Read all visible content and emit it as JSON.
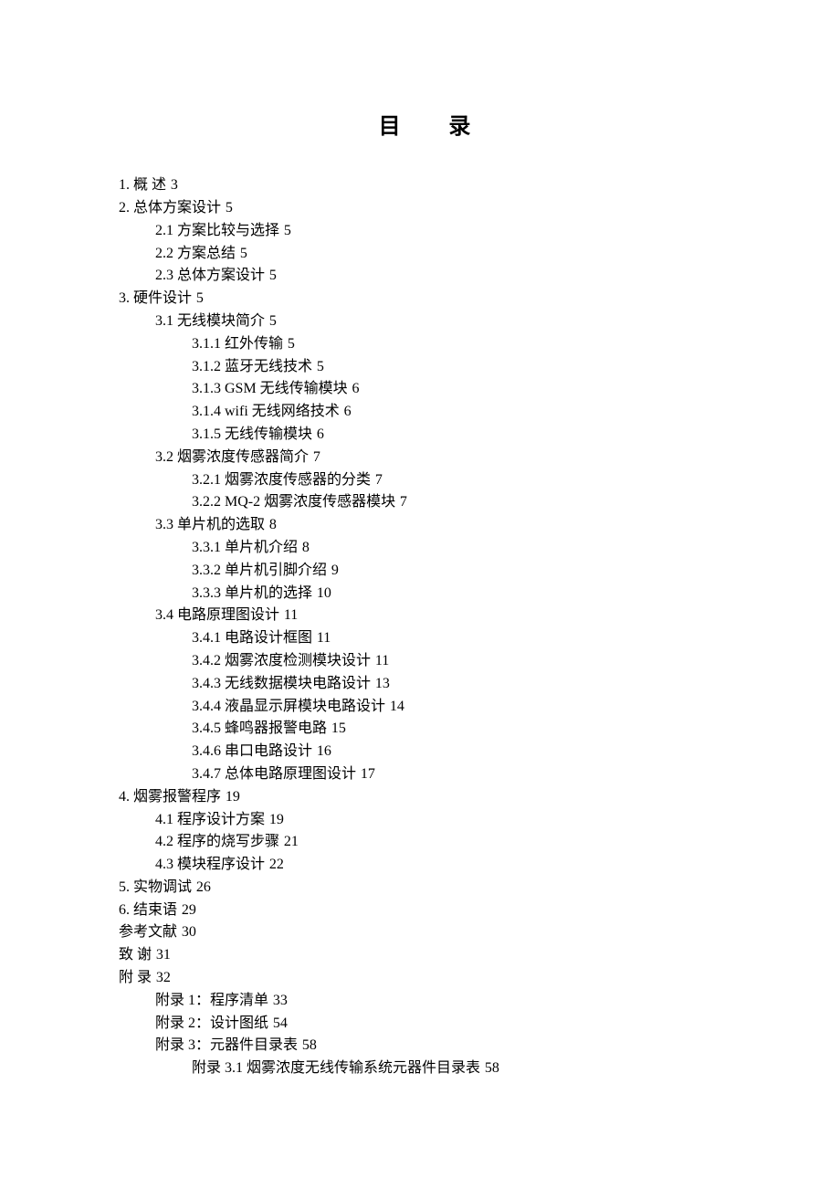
{
  "title_part1": "目",
  "title_part2": "录",
  "toc": [
    {
      "level": 0,
      "text": "1. 概    述",
      "page": "3"
    },
    {
      "level": 0,
      "text": "2. 总体方案设计",
      "page": "5"
    },
    {
      "level": 1,
      "text": "2.1 方案比较与选择",
      "page": "5"
    },
    {
      "level": 1,
      "text": "2.2 方案总结",
      "page": "5"
    },
    {
      "level": 1,
      "text": "2.3 总体方案设计",
      "page": "5"
    },
    {
      "level": 0,
      "text": "3. 硬件设计",
      "page": "5"
    },
    {
      "level": 1,
      "text": "3.1 无线模块简介",
      "page": "5"
    },
    {
      "level": 2,
      "text": "3.1.1 红外传输",
      "page": "5"
    },
    {
      "level": 2,
      "text": "3.1.2 蓝牙无线技术",
      "page": "5"
    },
    {
      "level": 2,
      "text": "3.1.3 GSM 无线传输模块",
      "page": "6"
    },
    {
      "level": 2,
      "text": "3.1.4 wifi 无线网络技术",
      "page": "6"
    },
    {
      "level": 2,
      "text": "3.1.5 无线传输模块",
      "page": "6"
    },
    {
      "level": 1,
      "text": "3.2 烟雾浓度传感器简介",
      "page": "7"
    },
    {
      "level": 2,
      "text": "3.2.1 烟雾浓度传感器的分类",
      "page": "7"
    },
    {
      "level": 2,
      "text": "3.2.2 MQ-2 烟雾浓度传感器模块",
      "page": "7"
    },
    {
      "level": 1,
      "text": "3.3 单片机的选取",
      "page": "8"
    },
    {
      "level": 2,
      "text": "3.3.1 单片机介绍",
      "page": "8"
    },
    {
      "level": 2,
      "text": "3.3.2 单片机引脚介绍",
      "page": "9"
    },
    {
      "level": 2,
      "text": "3.3.3 单片机的选择",
      "page": "10"
    },
    {
      "level": 1,
      "text": "3.4 电路原理图设计",
      "page": "11"
    },
    {
      "level": 2,
      "text": "3.4.1 电路设计框图",
      "page": "11"
    },
    {
      "level": 2,
      "text": "3.4.2 烟雾浓度检测模块设计",
      "page": "11"
    },
    {
      "level": 2,
      "text": "3.4.3 无线数据模块电路设计",
      "page": "13"
    },
    {
      "level": 2,
      "text": "3.4.4 液晶显示屏模块电路设计",
      "page": "14"
    },
    {
      "level": 2,
      "text": "3.4.5 蜂鸣器报警电路",
      "page": "15"
    },
    {
      "level": 2,
      "text": "3.4.6 串口电路设计",
      "page": "16"
    },
    {
      "level": 2,
      "text": "3.4.7 总体电路原理图设计",
      "page": "17"
    },
    {
      "level": 0,
      "text": "4. 烟雾报警程序",
      "page": "19"
    },
    {
      "level": 1,
      "text": "4.1 程序设计方案",
      "page": "19"
    },
    {
      "level": 1,
      "text": "4.2 程序的烧写步骤",
      "page": "21"
    },
    {
      "level": 1,
      "text": "4.3 模块程序设计",
      "page": "22"
    },
    {
      "level": 0,
      "text": "5. 实物调试",
      "page": "26"
    },
    {
      "level": 0,
      "text": "6. 结束语",
      "page": "29"
    },
    {
      "level": 0,
      "text": "参考文献",
      "page": "30"
    },
    {
      "level": 0,
      "text": "致    谢",
      "page": "31"
    },
    {
      "level": 0,
      "text": "附    录",
      "page": "32"
    },
    {
      "level": 1,
      "text": "附录 1：程序清单",
      "page": "33"
    },
    {
      "level": 1,
      "text": "附录 2：设计图纸",
      "page": "54"
    },
    {
      "level": 1,
      "text": "附录 3：元器件目录表",
      "page": "58"
    },
    {
      "level": 2,
      "text": "附录 3.1 烟雾浓度无线传输系统元器件目录表",
      "page": "58"
    }
  ]
}
